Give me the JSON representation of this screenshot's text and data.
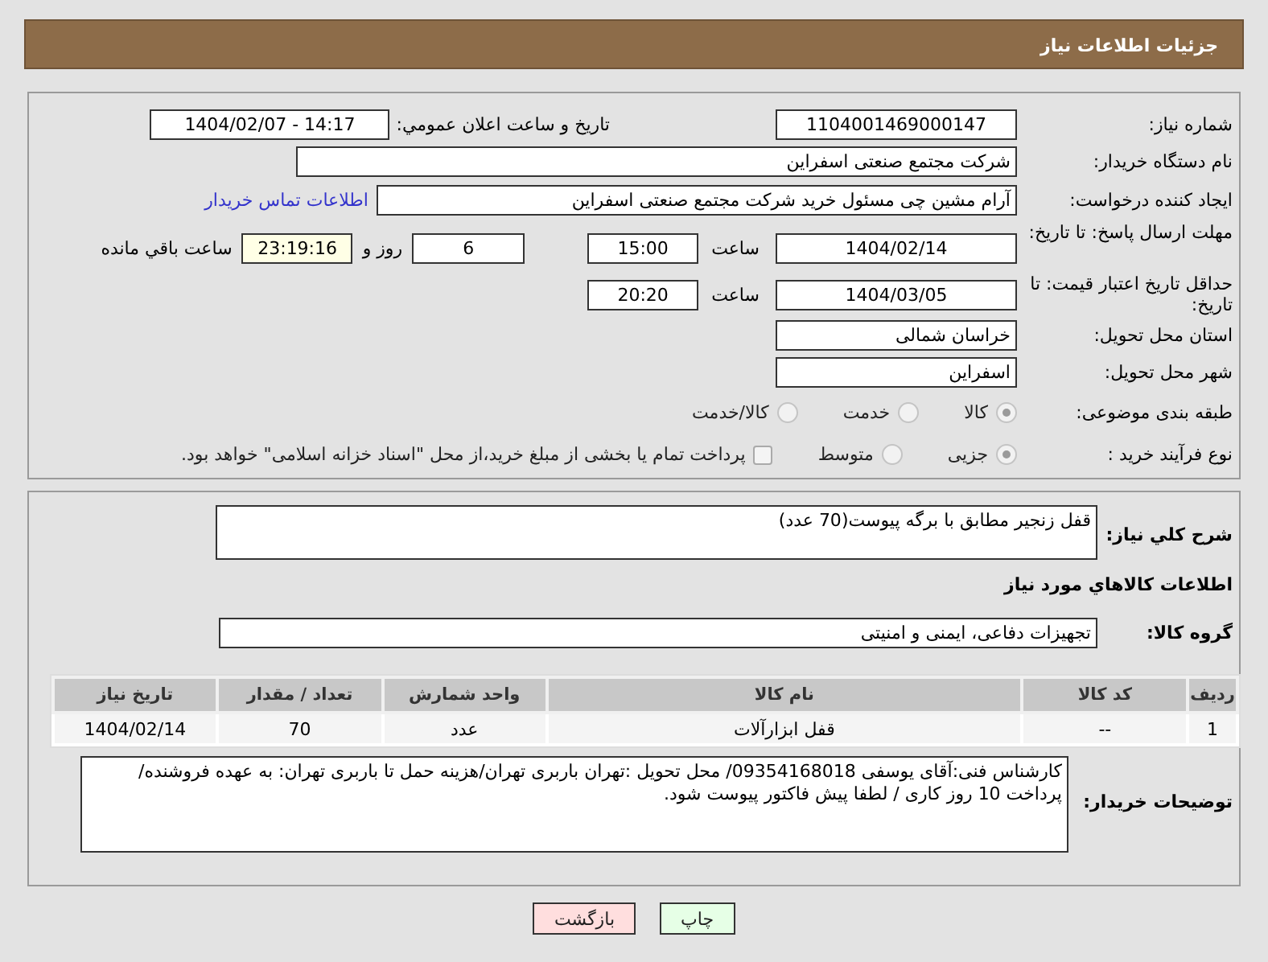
{
  "header": {
    "title": "جزئیات اطلاعات نیاز"
  },
  "need_number": {
    "label": "شماره نیاز:",
    "value": "1104001469000147"
  },
  "announce": {
    "label": "تاریخ و ساعت اعلان عمومي:",
    "value": "1404/02/07 - 14:17"
  },
  "buyer_org": {
    "label": "نام دستگاه خریدار:",
    "value": "شرکت مجتمع صنعتی اسفراین"
  },
  "creator": {
    "label": "ایجاد کننده درخواست:",
    "value": "آرام مشین چی مسئول خرید شرکت مجتمع صنعتی اسفراین",
    "link": "اطلاعات تماس خریدار"
  },
  "reply_deadline": {
    "label": "مهلت ارسال پاسخ: تا تاریخ:",
    "date": "1404/02/14",
    "time_label": "ساعت",
    "time": "15:00",
    "days": "6",
    "days_label": "روز و",
    "remaining": "23:19:16",
    "remaining_label": "ساعت باقي مانده"
  },
  "price_validity": {
    "label": "حداقل تاریخ اعتبار قیمت: تا تاریخ:",
    "date": "1404/03/05",
    "time_label": "ساعت",
    "time": "20:20"
  },
  "province": {
    "label": "استان محل تحویل:",
    "value": "خراسان شمالی"
  },
  "city": {
    "label": "شهر محل تحویل:",
    "value": "اسفراین"
  },
  "category": {
    "label": "طبقه بندی موضوعی:",
    "options": [
      {
        "label": "کالا",
        "selected": true
      },
      {
        "label": "خدمت",
        "selected": false
      },
      {
        "label": "کالا/خدمت",
        "selected": false
      }
    ]
  },
  "purchase_type": {
    "label": "نوع فرآیند خرید :",
    "options": [
      {
        "label": "جزیی",
        "selected": true
      },
      {
        "label": "متوسط",
        "selected": false
      }
    ],
    "treasury": {
      "label": "پرداخت تمام یا بخشی از مبلغ خرید،از محل \"اسناد خزانه اسلامی\" خواهد بود.",
      "checked": false
    }
  },
  "description": {
    "label": "شرح کلي نیاز:",
    "value": "قفل زنجیر مطابق با برگه پیوست(70 عدد)"
  },
  "goods_title": "اطلاعات کالاهاي مورد نیاز",
  "goods_group": {
    "label": "گروه کالا:",
    "value": "تجهیزات دفاعی، ایمنی و امنیتی"
  },
  "table": {
    "columns": [
      "ردیف",
      "کد کالا",
      "نام کالا",
      "واحد شمارش",
      "تعداد / مقدار",
      "تاریخ نیاز"
    ],
    "rows": [
      [
        "1",
        "--",
        "قفل ابزارآلات",
        "عدد",
        "70",
        "1404/02/14"
      ]
    ]
  },
  "notes": {
    "label": "توضیحات خریدار:",
    "value": "کارشناس فنی:آقای یوسفی 09354168018/ محل تحویل :تهران باربری تهران/هزینه حمل تا باربری تهران: به عهده فروشنده/ پرداخت 10 روز کاری / لطفا پیش فاکتور پیوست شود."
  },
  "buttons": [
    {
      "label": "چاپ",
      "kind": "print"
    },
    {
      "label": "بازگشت",
      "kind": "back"
    }
  ]
}
